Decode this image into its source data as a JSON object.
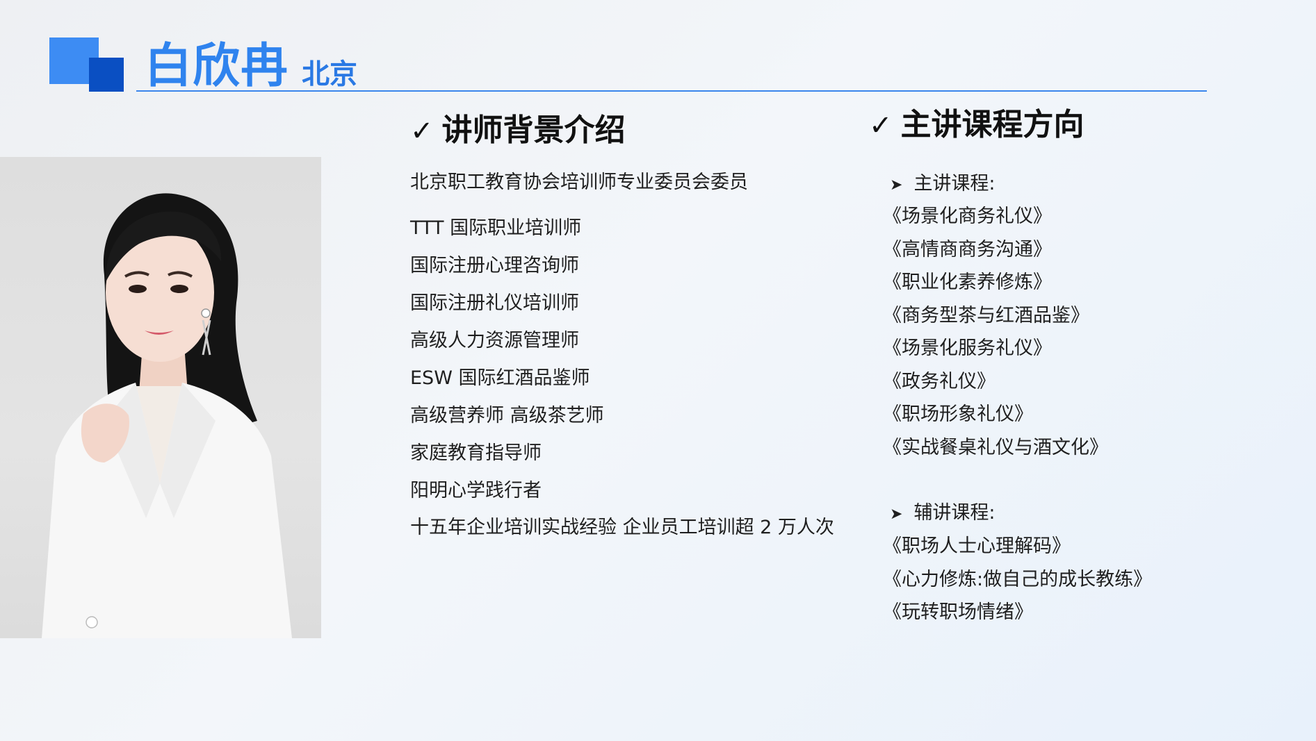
{
  "header": {
    "name": "白欣冉",
    "city": "北京"
  },
  "colors": {
    "accent": "#2f83ee",
    "accent_dark": "#0a4fc2"
  },
  "photo": {
    "alt": "portrait"
  },
  "background": {
    "title": "讲师背景介绍",
    "items": [
      "北京职工教育协会培训师专业委员会委员",
      "TTT 国际职业培训师",
      "国际注册心理咨询师",
      "国际注册礼仪培训师",
      "高级人力资源管理师",
      "ESW 国际红酒品鉴师",
      "高级营养师 高级茶艺师",
      "家庭教育指导师",
      "阳明心学践行者",
      "十五年企业培训实战经验 企业员工培训超 2 万人次"
    ]
  },
  "courses": {
    "title": "主讲课程方向",
    "main_label": "主讲课程:",
    "main": [
      "《场景化商务礼仪》",
      "《高情商商务沟通》",
      "《职业化素养修炼》",
      "《商务型茶与红酒品鉴》",
      "《场景化服务礼仪》",
      "《政务礼仪》",
      "《职场形象礼仪》",
      "《实战餐桌礼仪与酒文化》"
    ],
    "aux_label": "辅讲课程:",
    "aux": [
      "《职场人士心理解码》",
      "《心力修炼:做自己的成长教练》",
      "《玩转职场情绪》"
    ]
  }
}
